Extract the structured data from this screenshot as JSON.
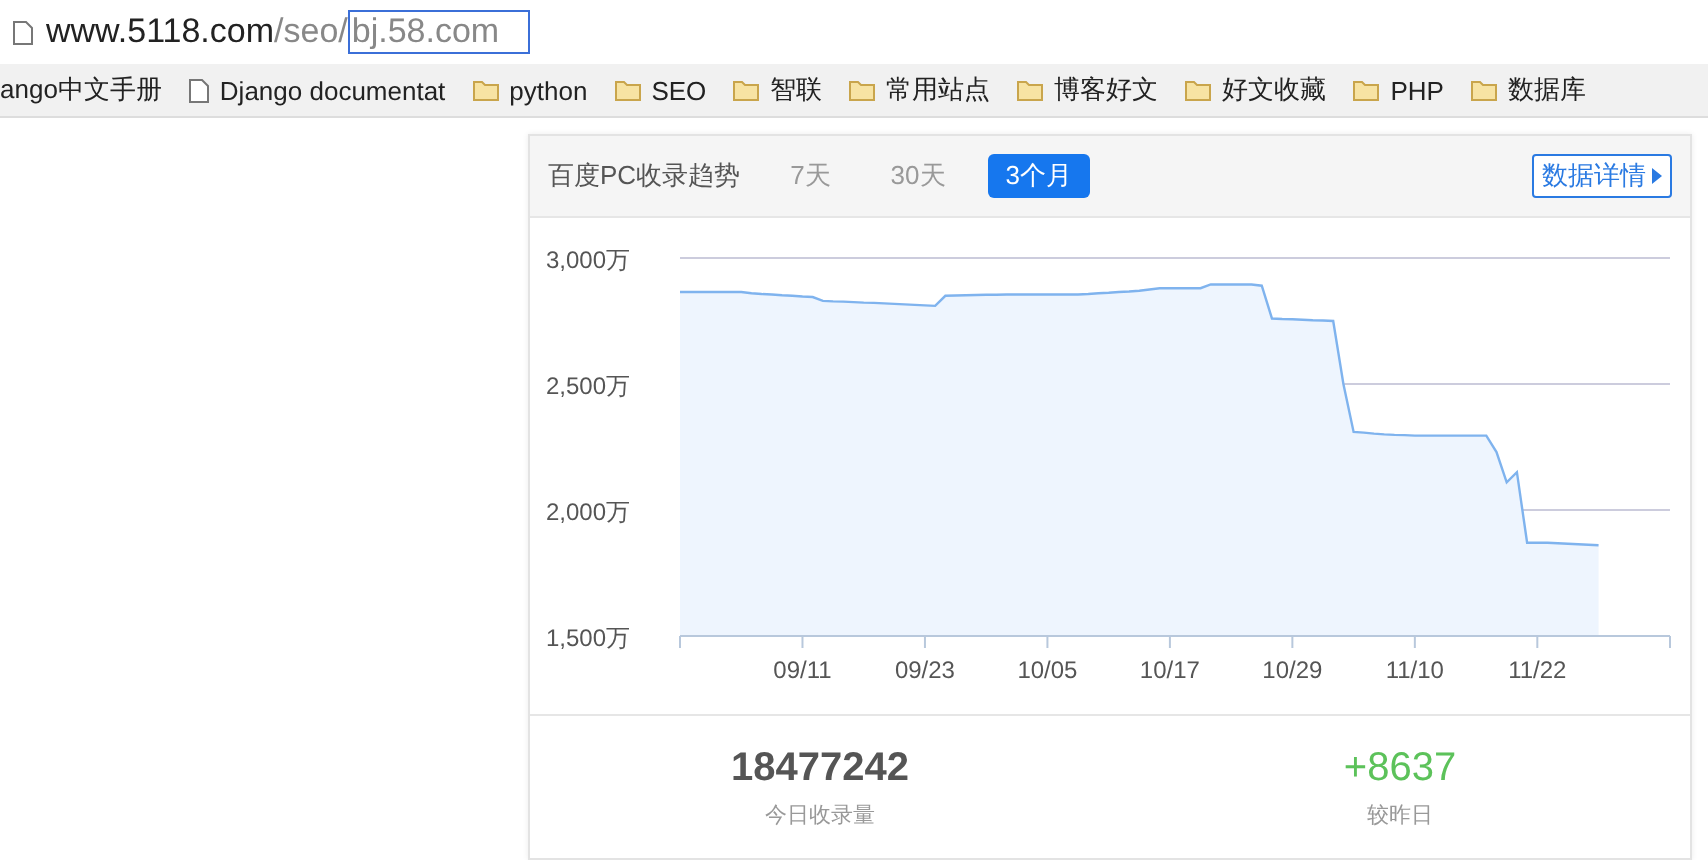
{
  "address_bar": {
    "host": "www.5118.com",
    "path": "/seo/",
    "selected_text": "bj.58.com"
  },
  "bookmarks": [
    {
      "label": "ango中文手册",
      "kind": "text"
    },
    {
      "label": "Django documentat",
      "kind": "page"
    },
    {
      "label": "python",
      "kind": "folder"
    },
    {
      "label": "SEO",
      "kind": "folder"
    },
    {
      "label": "智联",
      "kind": "folder"
    },
    {
      "label": "常用站点",
      "kind": "folder"
    },
    {
      "label": "博客好文",
      "kind": "folder"
    },
    {
      "label": "好文收藏",
      "kind": "folder"
    },
    {
      "label": "PHP",
      "kind": "folder"
    },
    {
      "label": "数据库",
      "kind": "folder"
    }
  ],
  "card": {
    "title": "百度PC收录趋势",
    "tabs": [
      {
        "label": "7天",
        "selected": false
      },
      {
        "label": "30天",
        "selected": false
      },
      {
        "label": "3个月",
        "selected": true
      }
    ],
    "details_button": "数据详情",
    "chart_data": {
      "type": "area",
      "ylim": [
        1500,
        3000
      ],
      "yticks": [
        {
          "value": 1500,
          "label": "1,500万"
        },
        {
          "value": 2000,
          "label": "2,000万"
        },
        {
          "value": 2500,
          "label": "2,500万"
        },
        {
          "value": 3000,
          "label": "3,000万"
        }
      ],
      "categories": [
        null,
        null,
        null,
        null,
        null,
        null,
        null,
        null,
        null,
        null,
        null,
        null,
        "09/11",
        null,
        null,
        null,
        null,
        null,
        null,
        null,
        null,
        null,
        null,
        null,
        "09/23",
        null,
        null,
        null,
        null,
        null,
        null,
        null,
        null,
        null,
        null,
        null,
        "10/05",
        null,
        null,
        null,
        null,
        null,
        null,
        null,
        null,
        null,
        null,
        null,
        "10/17",
        null,
        null,
        null,
        null,
        null,
        null,
        null,
        null,
        null,
        null,
        null,
        "10/29",
        null,
        null,
        null,
        null,
        null,
        null,
        null,
        null,
        null,
        null,
        null,
        "11/10",
        null,
        null,
        null,
        null,
        null,
        null,
        null,
        null,
        null,
        null,
        null,
        "11/22",
        null,
        null,
        null,
        null,
        null,
        null,
        null,
        null,
        null,
        null,
        null,
        null,
        null
      ],
      "series": [
        {
          "color": "#7fb3ee",
          "values": [
            2865,
            2865,
            2865,
            2865,
            2865,
            2865,
            2865,
            2860,
            2857,
            2855,
            2852,
            2850,
            2847,
            2845,
            2830,
            2828,
            2827,
            2825,
            2823,
            2822,
            2820,
            2818,
            2816,
            2814,
            2812,
            2810,
            2850,
            2851,
            2852,
            2853,
            2854,
            2854,
            2855,
            2855,
            2855,
            2855,
            2855,
            2855,
            2855,
            2855,
            2857,
            2860,
            2862,
            2865,
            2867,
            2870,
            2875,
            2880,
            2880,
            2880,
            2880,
            2880,
            2895,
            2895,
            2895,
            2895,
            2895,
            2890,
            2760,
            2758,
            2757,
            2755,
            2753,
            2752,
            2750,
            2500,
            2310,
            2307,
            2303,
            2300,
            2298,
            2297,
            2295,
            2295,
            2295,
            2295,
            2295,
            2295,
            2295,
            2295,
            2230,
            2110,
            2150,
            1870,
            1870,
            1870,
            1868,
            1866,
            1864,
            1862,
            1860,
            null,
            null,
            null,
            null,
            null,
            null,
            null
          ]
        }
      ]
    },
    "stats": [
      {
        "value": "18477242",
        "label": "今日收录量",
        "kind": "total"
      },
      {
        "value": "+8637",
        "label": "较昨日",
        "kind": "change"
      }
    ]
  }
}
